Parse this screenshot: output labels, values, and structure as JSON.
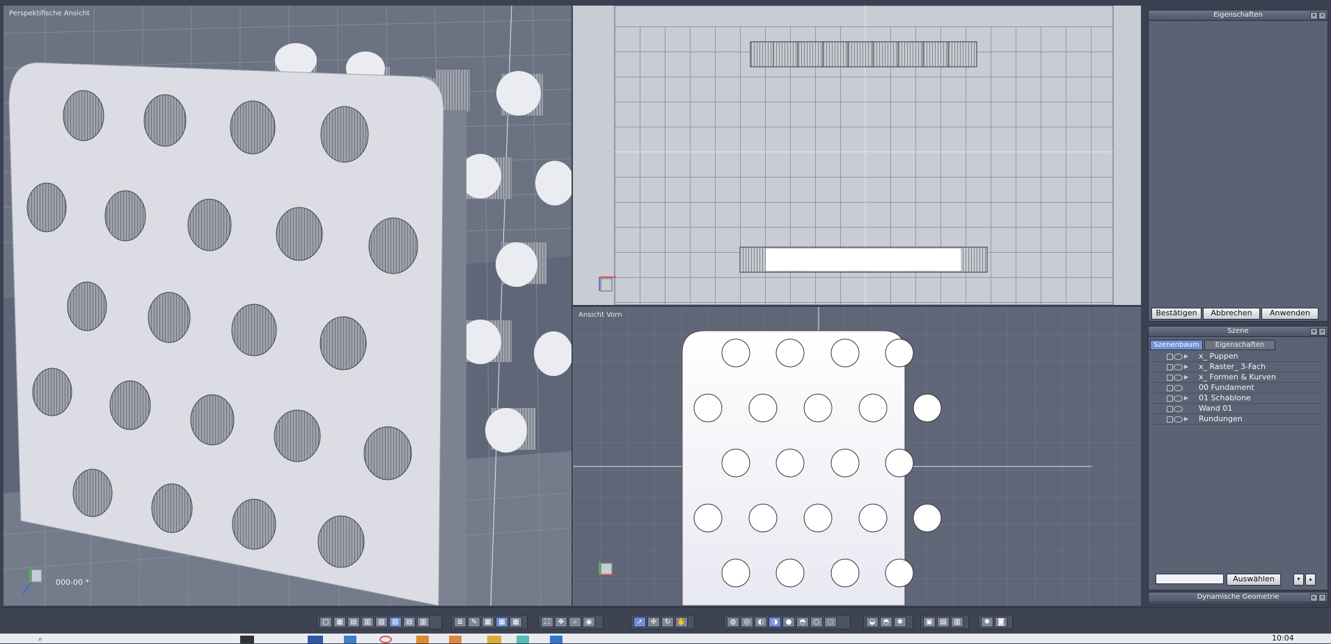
{
  "viewports": {
    "perspective_label": "Perspektifische Ansicht",
    "top_label": "",
    "front_label": "Ansicht Vorn",
    "coord_readout": "000-00 *",
    "axis_x": "x",
    "axis_y": "y",
    "axis_z": "z"
  },
  "properties_panel": {
    "title": "Eigenschaften",
    "confirm": "Bestätigen",
    "cancel": "Abbrechen",
    "apply": "Anwenden"
  },
  "scene_panel": {
    "title": "Szene",
    "tabs": [
      "Szenenbaum",
      "Eigenschaften"
    ],
    "items": [
      {
        "label": "x_ Puppen",
        "expandable": true
      },
      {
        "label": "x_ Raster_ 3-Fach",
        "expandable": true
      },
      {
        "label": "x_ Formen & Kurven",
        "expandable": true
      },
      {
        "label": "00 Fundament",
        "expandable": false
      },
      {
        "label": "01 Schablone",
        "expandable": true
      },
      {
        "label": "Wand 01",
        "expandable": false
      },
      {
        "label": "Rundungen",
        "expandable": true
      }
    ],
    "select_button": "Auswählen"
  },
  "dyn_geometry_panel": {
    "title": "Dynamische Geometrie"
  },
  "taskbar": {
    "clock": "10:04"
  },
  "colors": {
    "accent": "#6f8fd6",
    "panel": "#5a6273",
    "viewport_grid": "#4a5062"
  }
}
